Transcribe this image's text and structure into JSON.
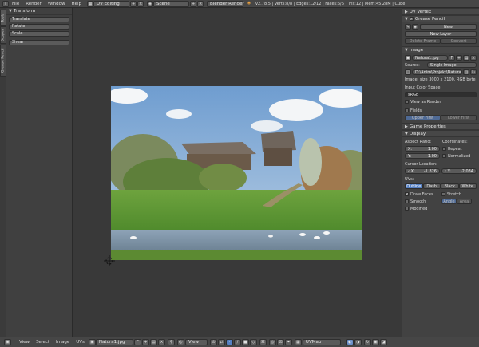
{
  "top_bar": {
    "menus": [
      "File",
      "Render",
      "Window",
      "Help"
    ],
    "screen_layout": "UV Editing",
    "scene": "Scene",
    "render_engine": "Blender Render",
    "stats": "v2.78.5 | Verts:8/8 | Edges:12/12 | Faces:6/6 | Tris:12 | Mem:45.28M | Cube"
  },
  "left_tabs": [
    "Tools",
    "Scopes",
    "Grease Pencil"
  ],
  "tool_shelf": {
    "panel_title": "Transform",
    "tools": [
      "Translate",
      "Rotate",
      "Scale",
      "Shear"
    ]
  },
  "sidebar": {
    "uv_vertex_title": "UV Vertex",
    "grease_pencil_title": "Grease Pencil",
    "grease_new": "New",
    "new_layer": "New Layer",
    "delete_frame": "Delete Frame",
    "convert": "Convert",
    "image_title": "Image",
    "image_name": "Natura1.jpg",
    "image_f": "F",
    "source_label": "Source:",
    "source_value": "Single Image",
    "file_path": "D:\\Anim\\Projekt\\Natura1.jpg",
    "image_info": "Image: size 3000 x 2100, RGB byte",
    "input_color_space_label": "Input Color Space",
    "color_space_value": "sRGB",
    "view_as_render": "View as Render",
    "fields": "Fields",
    "upper_first": "Upper First",
    "lower_first": "Lower First",
    "game_properties_title": "Game Properties",
    "display_title": "Display",
    "aspect_ratio_label": "Aspect Ratio:",
    "aspect_x_label": "X:",
    "aspect_x_value": "1.00",
    "aspect_y_label": "Y:",
    "aspect_y_value": "1.00",
    "coordinates_label": "Coordinates:",
    "repeat": "Repeat",
    "normalized": "Normalized",
    "cursor_location_label": "Cursor Location:",
    "cursor_x": "-1.826",
    "cursor_y": "-2.034",
    "uvs_label": "UVs:",
    "uv_styles": [
      "Outline",
      "Dash",
      "Black",
      "White"
    ],
    "draw_faces": "Draw Faces",
    "stretch": "Stretch",
    "smooth": "Smooth",
    "modified": "Modified",
    "angle": "Angle",
    "area": "Area"
  },
  "bottom_bar": {
    "menus": [
      "View",
      "Select",
      "Image",
      "UVs"
    ],
    "image_name": "Natura1.jpg",
    "image_f": "F",
    "view_mode": "View",
    "uv_map": "UVMap"
  },
  "colors": {
    "accent": "#5680c2",
    "panel": "#424242",
    "header": "#464646",
    "viewport": "#393939"
  }
}
